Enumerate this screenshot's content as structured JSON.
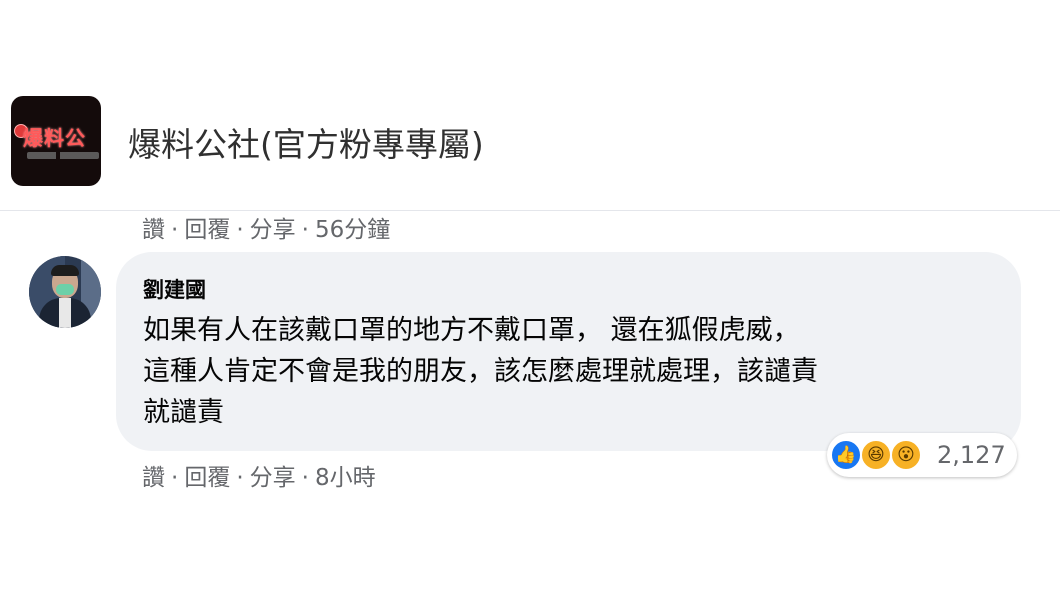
{
  "page": {
    "title": "爆料公社(官方粉專專屬)",
    "logo_text": "爆料公"
  },
  "first_comment": {
    "actions": {
      "like": "讚",
      "reply": "回覆",
      "share": "分享",
      "time": "56分鐘"
    }
  },
  "comment": {
    "author": "劉建國",
    "text_lines": [
      "如果有人在該戴口罩的地方不戴口罩， 還在狐假虎威，",
      "這種人肯定不會是我的朋友，該怎麼處理就處理，該譴責",
      "就譴責"
    ],
    "actions": {
      "like": "讚",
      "reply": "回覆",
      "share": "分享",
      "time": "8小時"
    },
    "reactions": {
      "icons": [
        "like-icon",
        "haha-icon",
        "wow-icon"
      ],
      "count": "2,127"
    }
  },
  "separator": "·",
  "colors": {
    "bubble": "#f0f2f5",
    "meta_text": "#65676b",
    "like_blue": "#1877f2",
    "emoji_yellow": "#f7b125"
  }
}
